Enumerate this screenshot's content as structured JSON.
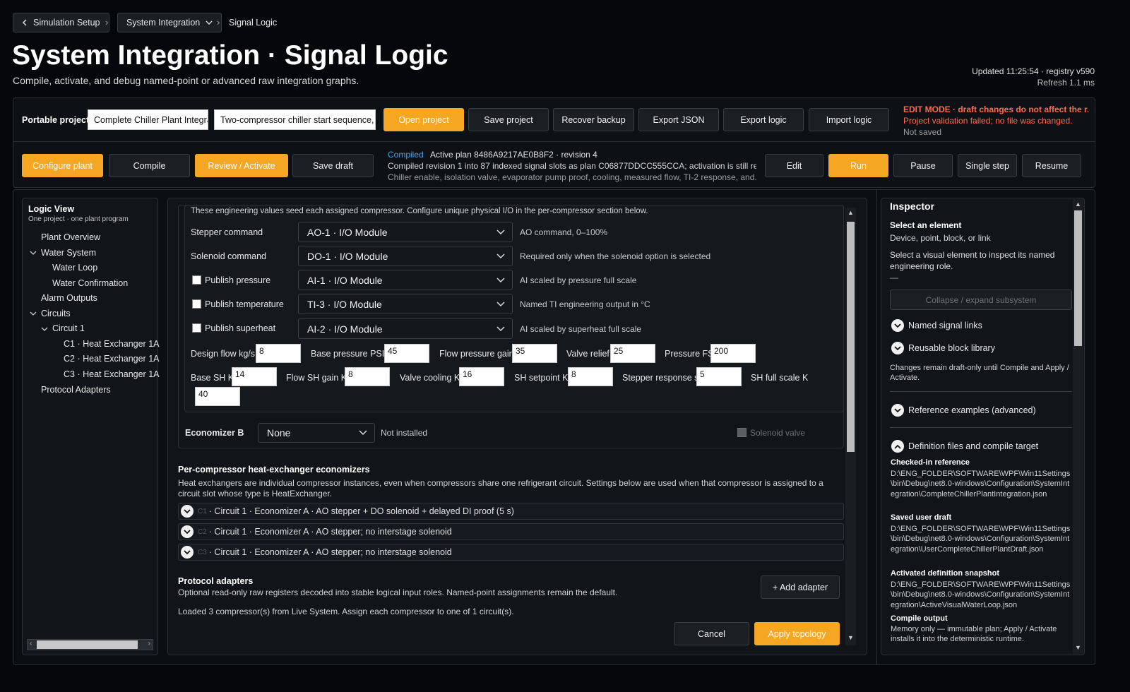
{
  "breadcrumb": {
    "back": "Simulation Setup",
    "middle": "System Integration",
    "current": "Signal Logic"
  },
  "header": {
    "title": "System Integration · Signal Logic",
    "subtitle": "Compile, activate, and debug named-point or advanced raw integration graphs.",
    "updated": "Updated 11:25:54 · registry v590",
    "refresh": "Refresh 1.1 ms"
  },
  "project": {
    "label": "Portable project",
    "name_value": "Complete Chiller Plant Integra",
    "desc_value": "Two-compressor chiller start sequence, m",
    "open": "Open project",
    "save": "Save project",
    "recover": "Recover backup",
    "export_json": "Export JSON",
    "export_logic": "Export logic",
    "import_logic": "Import logic",
    "edit_mode": "EDIT MODE · draft changes do not affect the r...",
    "validation": "Project validation failed; no file was changed.",
    "not_saved": "Not saved"
  },
  "toolbar": {
    "configure": "Configure plant",
    "compile": "Compile",
    "review": "Review / Activate",
    "save_draft": "Save draft",
    "status_label": "Compiled",
    "status_plan": "Active plan 8486A9217AE0B8F2 · revision 4",
    "status_line2": "Compiled revision 1 into 87 indexed signal slots as plan C06877DDCC555CCA; activation is still req...",
    "status_line3": "Chiller enable, isolation valve, evaporator pump proof, cooling, measured flow, TI-2 response, and...",
    "edit": "Edit",
    "run": "Run",
    "pause": "Pause",
    "single_step": "Single step",
    "resume": "Resume"
  },
  "logic_view": {
    "title": "Logic View",
    "subtitle": "One project · one plant program",
    "items": [
      "Plant Overview",
      "Water System",
      "Water Loop",
      "Water Confirmation",
      "Alarm Outputs",
      "Circuits",
      "Circuit 1",
      "C1 · Heat Exchanger 1A",
      "C2 · Heat Exchanger 1A",
      "C3 · Heat Exchanger 1A",
      "Protocol Adapters"
    ]
  },
  "main": {
    "intro": "These engineering values seed each assigned compressor. Configure unique physical I/O in the per-compressor section below.",
    "rows": [
      {
        "label": "Stepper command",
        "value": "AO-1 · I/O Module",
        "hint": "AO command, 0–100%"
      },
      {
        "label": "Solenoid command",
        "value": "DO-1 · I/O Module",
        "hint": "Required only when the solenoid option is selected"
      },
      {
        "label": "Publish pressure",
        "value": "AI-1 · I/O Module",
        "hint": "AI scaled by pressure full scale"
      },
      {
        "label": "Publish temperature",
        "value": "TI-3 · I/O Module",
        "hint": "Named TI engineering output in °C"
      },
      {
        "label": "Publish superheat",
        "value": "AI-2 · I/O Module",
        "hint": "AI scaled by superheat full scale"
      }
    ],
    "params": [
      {
        "label": "Design flow kg/s",
        "value": "8"
      },
      {
        "label": "Base pressure PSIG",
        "value": "45"
      },
      {
        "label": "Flow pressure gain",
        "value": "35"
      },
      {
        "label": "Valve relief",
        "value": "25"
      },
      {
        "label": "Pressure FS",
        "value": "200"
      },
      {
        "label": "Base SH K",
        "value": "14"
      },
      {
        "label": "Flow SH gain K",
        "value": "8"
      },
      {
        "label": "Valve cooling K",
        "value": "16"
      },
      {
        "label": "SH setpoint K",
        "value": "8"
      },
      {
        "label": "Stepper response s",
        "value": "5"
      },
      {
        "label": "SH full scale K",
        "value": "40"
      }
    ],
    "economizer_b": {
      "label": "Economizer B",
      "value": "None",
      "status": "Not installed",
      "solenoid": "Solenoid valve"
    },
    "per_comp": {
      "title": "Per-compressor heat-exchanger economizers",
      "desc": "Heat exchangers are individual compressor instances, even when compressors share one refrigerant circuit. Settings below are used when that compressor is assigned to a circuit slot whose type is HeatExchanger.",
      "items": [
        {
          "tag": "C1",
          "text": "· Circuit 1 · Economizer A · AO stepper + DO solenoid + delayed DI proof (5 s)"
        },
        {
          "tag": "C2",
          "text": "· Circuit 1 · Economizer A · AO stepper; no interstage solenoid"
        },
        {
          "tag": "C3",
          "text": "· Circuit 1 · Economizer A · AO stepper; no interstage solenoid"
        }
      ]
    },
    "adapters": {
      "title": "Protocol adapters",
      "desc": "Optional read-only raw registers decoded into stable logical input roles. Named-point assignments remain the default.",
      "add": "+ Add adapter",
      "loaded": "Loaded 3 compressor(s) from Live System. Assign each compressor to one of 1 circuit(s)."
    },
    "cancel": "Cancel",
    "apply": "Apply topology"
  },
  "inspector": {
    "title": "Inspector",
    "select": "Select an element",
    "select_sub": "Device, point, block, or link",
    "select_desc": "Select a visual element to inspect its named engineering role.",
    "dash": "—",
    "collapse": "Collapse / expand subsystem",
    "named_links": "Named signal links",
    "block_library": "Reusable block library",
    "draft_note": "Changes remain draft-only until Compile and Apply / Activate.",
    "reference": "Reference examples (advanced)",
    "definition": "Definition files and compile target",
    "checked_in": "Checked-in reference",
    "checked_in_path": "D:\\ENG_FOLDER\\SOFTWARE\\WPF\\Win11Settings\\bin\\Debug\\net8.0-windows\\Configuration\\SystemIntegration\\CompleteChillerPlantIntegration.json",
    "saved_draft": "Saved user draft",
    "saved_draft_path": "D:\\ENG_FOLDER\\SOFTWARE\\WPF\\Win11Settings\\bin\\Debug\\net8.0-windows\\Configuration\\SystemIntegration\\UserCompleteChillerPlantDraft.json",
    "activated": "Activated definition snapshot",
    "activated_path": "D:\\ENG_FOLDER\\SOFTWARE\\WPF\\Win11Settings\\bin\\Debug\\net8.0-windows\\Configuration\\SystemIntegration\\ActiveVisualWaterLoop.json",
    "compile_output": "Compile output",
    "compile_output_desc": "Memory only — immutable plan; Apply / Activate installs it into the deterministic runtime."
  },
  "colors": {
    "accent": "#f5a623",
    "compiled": "#4aa3e8",
    "error": "#ff6a4d"
  }
}
